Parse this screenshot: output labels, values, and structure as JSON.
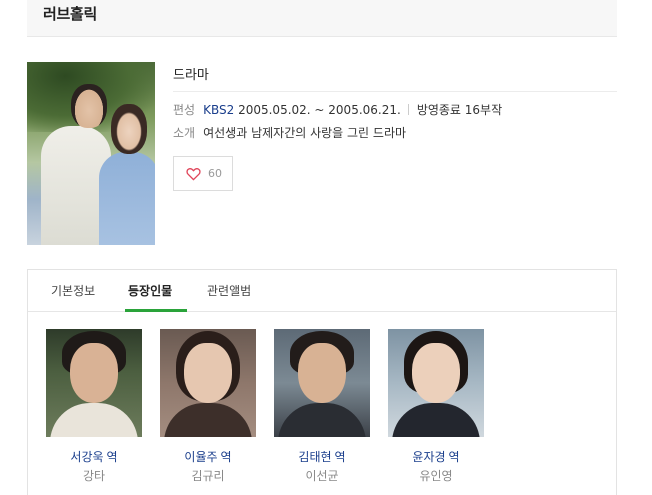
{
  "page": {
    "title": "러브홀릭"
  },
  "info": {
    "genre": "드라마",
    "schedule_label": "편성",
    "broadcaster": "KBS2",
    "period": "2005.05.02. ~ 2005.06.21.",
    "status": "방영종료 16부작",
    "summary_label": "소개",
    "summary": "여선생과 남제자간의 사랑을 그린 드라마",
    "like_count": "60"
  },
  "tabs": [
    {
      "label": "기본정보"
    },
    {
      "label": "등장인물"
    },
    {
      "label": "관련앨범"
    }
  ],
  "active_tab": "등장인물",
  "cast": [
    {
      "actor": "서강욱",
      "suffix": "역",
      "character": "강타"
    },
    {
      "actor": "이율주",
      "suffix": "역",
      "character": "김규리"
    },
    {
      "actor": "김태현",
      "suffix": "역",
      "character": "이선균"
    },
    {
      "actor": "윤자경",
      "suffix": "역",
      "character": "유인영"
    }
  ],
  "colors": {
    "link": "#1a3e8c",
    "active_tab_underline": "#2aa33a",
    "heart": "#e0455a"
  }
}
